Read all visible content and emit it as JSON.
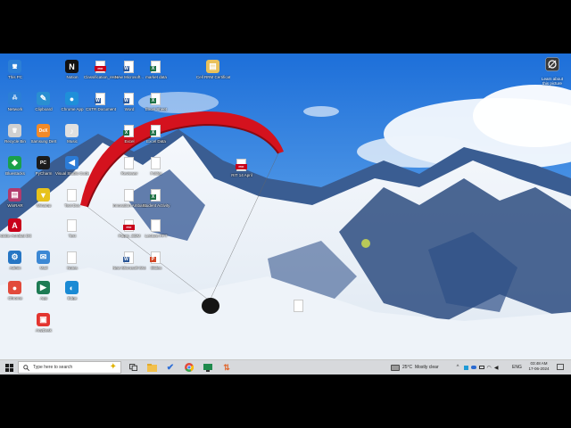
{
  "desktop": {
    "icons": [
      {
        "id": "this-pc",
        "label": "This PC",
        "glyph": "🖥",
        "color": "#2b7fd6"
      },
      {
        "id": "network",
        "label": "Network",
        "glyph": "🖧",
        "color": "#2b7fd6"
      },
      {
        "id": "recycle-bin",
        "label": "Recycle Bin",
        "glyph": "🗑",
        "color": "#d0d0d0"
      },
      {
        "id": "bluestacks",
        "label": "Bluestacks",
        "glyph": "◆",
        "color": "#1aa04a"
      },
      {
        "id": "winrar",
        "label": "WinRAR",
        "glyph": "▤",
        "color": "#b23a6c"
      },
      {
        "id": "adobe-acrobat",
        "label": "Adobe Acrobat DC",
        "glyph": "A",
        "color": "#c8001a"
      },
      {
        "id": "admin",
        "label": "Admin",
        "glyph": "⚙",
        "color": "#2676c4"
      },
      {
        "id": "chrome",
        "label": "Chrome",
        "glyph": "●",
        "color": "#e24a3b"
      },
      {
        "id": "notion",
        "label": "Notion",
        "glyph": "N",
        "color": "#111111"
      },
      {
        "id": "clipboard",
        "label": "Clipboard",
        "glyph": "✎",
        "color": "#2a8fd1"
      },
      {
        "id": "dex",
        "label": "Samsung DeX",
        "glyph": "DeX",
        "color": "#f28a28"
      },
      {
        "id": "pycharm",
        "label": "PyCharm",
        "glyph": "PC",
        "color": "#1b1b1b"
      },
      {
        "id": "winamp",
        "label": "Winamp",
        "glyph": "▼",
        "color": "#e7c21b"
      },
      {
        "id": "mail-app",
        "label": "Mail",
        "glyph": "✉",
        "color": "#3c88d4"
      },
      {
        "id": "app-green",
        "label": "App",
        "glyph": "▶",
        "color": "#1e7b54"
      },
      {
        "id": "anydesk",
        "label": "AnyDesk",
        "glyph": "▣",
        "color": "#e3342f"
      },
      {
        "id": "pdf-file",
        "label": "Classification_result",
        "glyph": "PDF",
        "color": "#c8001a"
      },
      {
        "id": "chrome-2",
        "label": "Chrome App",
        "glyph": "●",
        "color": "#1f8fd9"
      },
      {
        "id": "music",
        "label": "Music",
        "glyph": "♪",
        "color": "#e0e0e0"
      },
      {
        "id": "visual-studio",
        "label": "Visual Studio Code",
        "glyph": "◀",
        "color": "#2b7bd6"
      },
      {
        "id": "doc-plain",
        "label": "Text Doc",
        "glyph": "",
        "color": "#ffffff"
      },
      {
        "id": "doc-plain-2",
        "label": "Text",
        "glyph": "",
        "color": "#ffffff"
      },
      {
        "id": "doc-plain-3",
        "label": "Notes",
        "glyph": "",
        "color": "#ffffff"
      },
      {
        "id": "edge",
        "label": "Edge",
        "glyph": "◐",
        "color": "#1a8ad4"
      },
      {
        "id": "word-new",
        "label": "New Microsoft...",
        "glyph": "W",
        "color": "#2b5797"
      },
      {
        "id": "word-2",
        "label": "CSTR Document",
        "glyph": "W",
        "color": "#2b5797"
      },
      {
        "id": "word-3",
        "label": "Word",
        "glyph": "W",
        "color": "#2b5797"
      },
      {
        "id": "excel-1",
        "label": "Excel",
        "glyph": "X",
        "color": "#1e7145"
      },
      {
        "id": "file-2",
        "label": "Reviewer",
        "glyph": "",
        "color": "#ffffff"
      },
      {
        "id": "file-3",
        "label": "Innovation Ambassador",
        "glyph": "",
        "color": "#ffffff"
      },
      {
        "id": "pdf-2",
        "label": "Paper_SDM",
        "glyph": "PDF",
        "color": "#c8001a"
      },
      {
        "id": "word-4",
        "label": "New Microsoft Wor",
        "glyph": "W",
        "color": "#2b5797"
      },
      {
        "id": "excel-market",
        "label": "market data",
        "glyph": "X",
        "color": "#1e7145"
      },
      {
        "id": "excel-2",
        "label": "Excel Sheet",
        "glyph": "X",
        "color": "#1e7145"
      },
      {
        "id": "excel-3",
        "label": "Excel Data",
        "glyph": "X",
        "color": "#1e7145"
      },
      {
        "id": "file-4",
        "label": "Folder",
        "glyph": "",
        "color": "#ffffff"
      },
      {
        "id": "excel-4",
        "label": "Student Activity",
        "glyph": "X",
        "color": "#1e7145"
      },
      {
        "id": "file-5",
        "label": "Lecture PPT",
        "glyph": "",
        "color": "#ffffff"
      },
      {
        "id": "ppt-1",
        "label": "Slides",
        "glyph": "P",
        "color": "#d24726"
      },
      {
        "id": "cert-file",
        "label": "Cell RRM Certificate",
        "glyph": "▤",
        "color": "#e9c15b"
      },
      {
        "id": "pdf-3",
        "label": "RIT 14 April",
        "glyph": "PDF",
        "color": "#c8001a"
      },
      {
        "id": "blank-file",
        "label": "",
        "glyph": "",
        "color": "#ffffff"
      }
    ]
  },
  "oneclick": {
    "label": "Learn about this picture"
  },
  "taskbar": {
    "search_placeholder": "Type here to search",
    "weather": "25°C  Mostly clear",
    "language": "ENG",
    "time": "03:48 AM",
    "date": "17-06-2024"
  },
  "colors": {
    "accent": "#2b7fd6",
    "taskbar": "#d7d9dc"
  }
}
